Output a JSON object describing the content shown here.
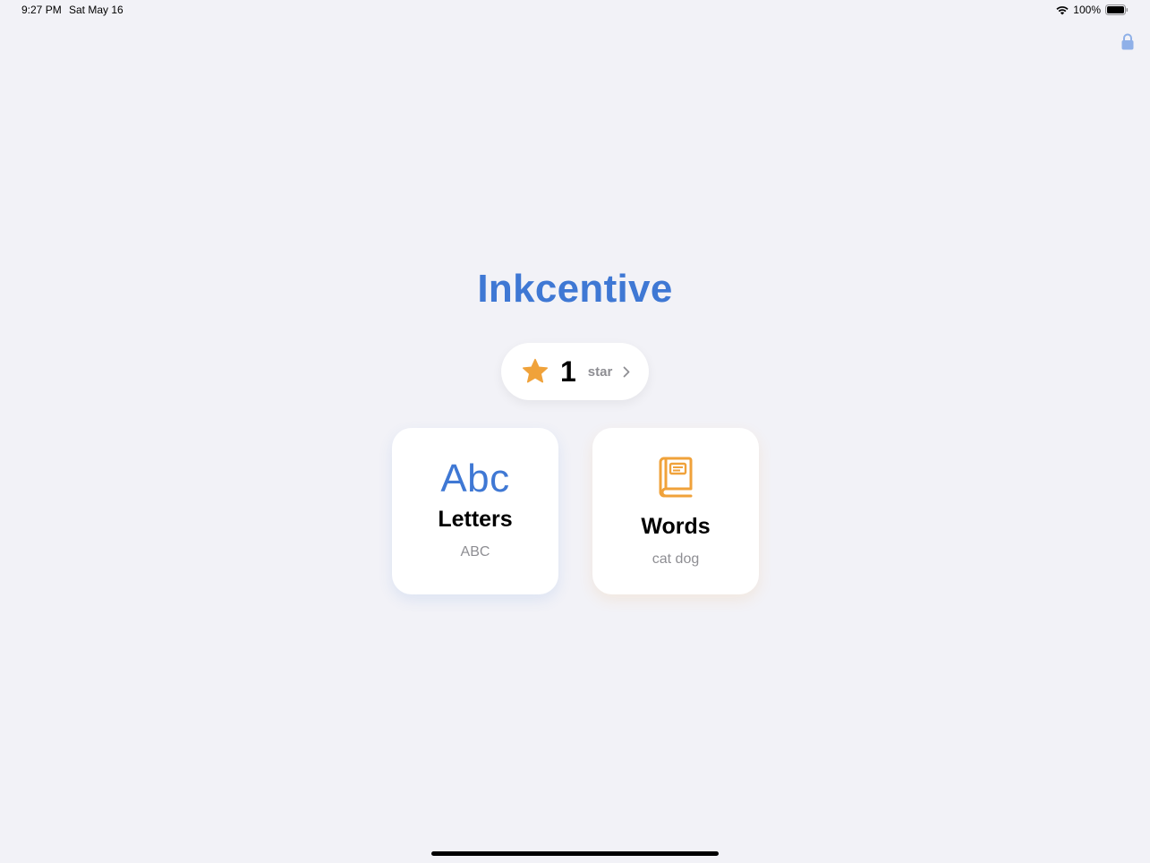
{
  "status_bar": {
    "time": "9:27 PM",
    "date": "Sat May 16",
    "battery": "100%",
    "wifi_icon": "wifi-icon",
    "battery_icon": "battery-icon"
  },
  "lock_icon": "lock-icon",
  "app": {
    "title": "Inkcentive",
    "accent_color": "#3f78d4",
    "orange_color": "#f0a23a"
  },
  "stars": {
    "count": "1",
    "label": "star",
    "icon": "star-icon"
  },
  "modes": [
    {
      "glyph": "Abc",
      "title": "Letters",
      "subtitle": "ABC",
      "icon": "abc-icon"
    },
    {
      "title": "Words",
      "subtitle": "cat dog",
      "icon": "book-icon"
    }
  ]
}
